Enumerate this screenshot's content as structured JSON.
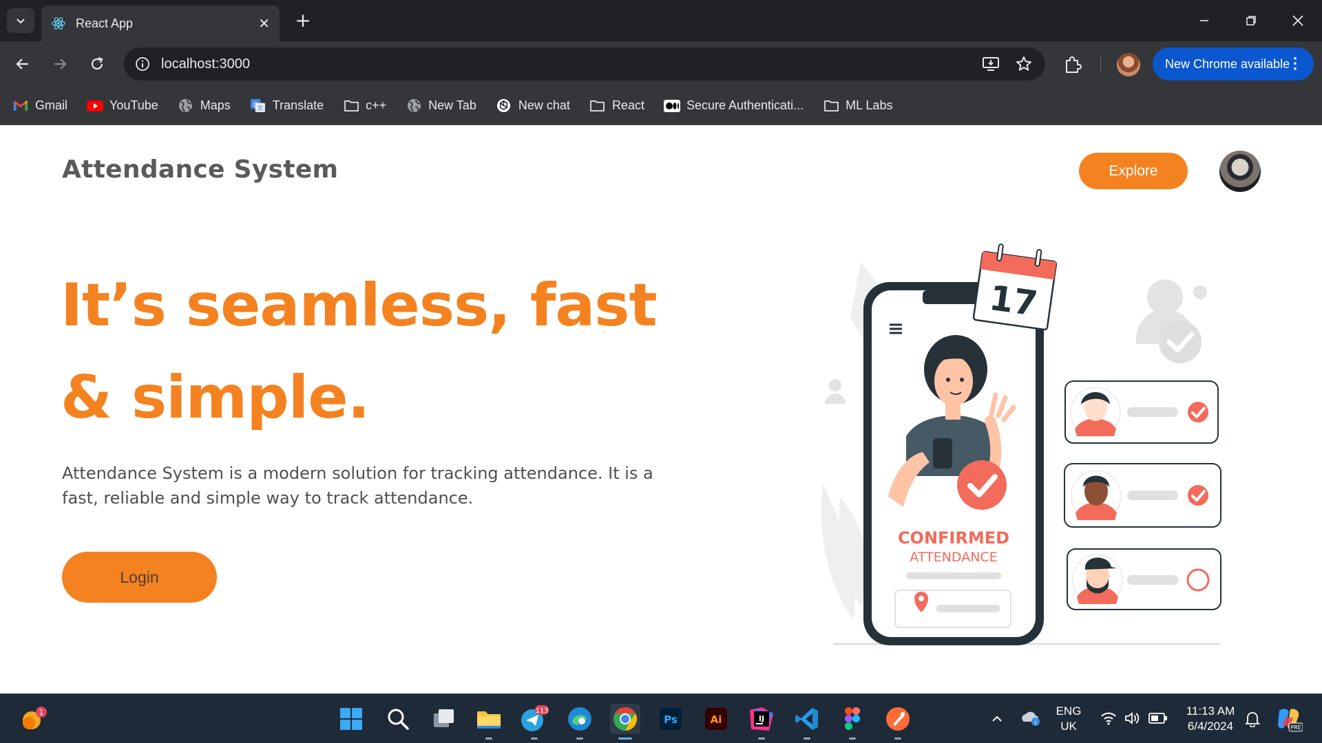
{
  "browser": {
    "tab_title": "React App",
    "address": "localhost:3000",
    "update_chip": "New Chrome available",
    "bookmarks": [
      {
        "label": "Gmail",
        "icon": "gmail-icon"
      },
      {
        "label": "YouTube",
        "icon": "youtube-icon"
      },
      {
        "label": "Maps",
        "icon": "globe-icon"
      },
      {
        "label": "Translate",
        "icon": "translate-icon"
      },
      {
        "label": "c++",
        "icon": "folder-icon"
      },
      {
        "label": "New Tab",
        "icon": "globe-icon"
      },
      {
        "label": "New chat",
        "icon": "chatgpt-icon"
      },
      {
        "label": "React",
        "icon": "folder-icon"
      },
      {
        "label": "Secure Authenticati...",
        "icon": "medium-icon"
      },
      {
        "label": "ML Labs",
        "icon": "folder-icon"
      }
    ]
  },
  "page": {
    "brand": "Attendance System",
    "explore_label": "Explore",
    "hero_line1": "It’s seamless, fast",
    "hero_line2": "& simple.",
    "description": "Attendance System is a modern solution for tracking attendance. It is a fast, reliable and simple way to track attendance.",
    "login_label": "Login",
    "accent_color": "#f58220",
    "illustration": {
      "calendar_day": "17",
      "confirmed": "CONFIRMED",
      "attendance": "ATTENDANCE",
      "accent": "#f26b5b"
    }
  },
  "taskbar": {
    "weather_badge": "1",
    "telegram_badge": "113",
    "language": "ENG",
    "region": "UK",
    "time": "11:13 AM",
    "date": "6/4/2024",
    "copilot_badge": "PRE",
    "apps": [
      "windows-start",
      "search",
      "task-view",
      "file-explorer",
      "telegram",
      "edge",
      "chrome",
      "photoshop",
      "illustrator",
      "intellij",
      "vscode",
      "figma",
      "postman"
    ]
  }
}
